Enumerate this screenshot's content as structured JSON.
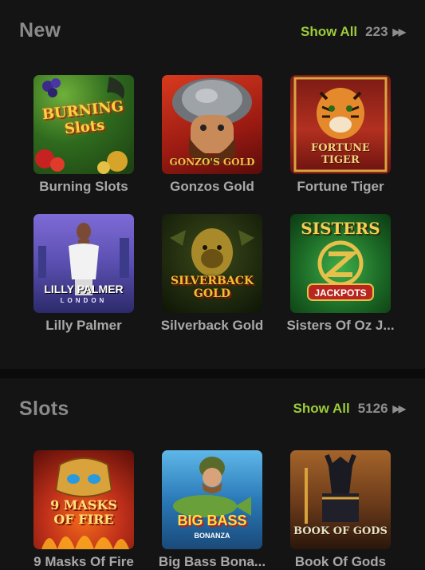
{
  "sections": [
    {
      "title": "New",
      "show_all_label": "Show All",
      "count": "223",
      "games": [
        {
          "name": "Burning Slots",
          "art_text": "BURNING Slots"
        },
        {
          "name": "Gonzos Gold",
          "art_text": "GONZO'S GOLD"
        },
        {
          "name": "Fortune Tiger",
          "art_text": "FORTUNE TIGER"
        },
        {
          "name": "Lilly Palmer",
          "art_text": "LILLY PALMER",
          "art_sub": "LONDON"
        },
        {
          "name": "Silverback Gold",
          "art_text": "SILVERBACK GOLD"
        },
        {
          "name": "Sisters Of Oz J...",
          "art_text": "SISTERS",
          "art_sub": "JACKPOTS"
        }
      ]
    },
    {
      "title": "Slots",
      "show_all_label": "Show All",
      "count": "5126",
      "games": [
        {
          "name": "9 Masks Of Fire",
          "art_text": "9 MASKS OF FIRE"
        },
        {
          "name": "Big Bass Bona...",
          "art_text": "BIG BASS",
          "art_sub": "BONANZA"
        },
        {
          "name": "Book Of Gods",
          "art_text": "BOOK OF GODS"
        }
      ]
    }
  ],
  "colors": {
    "accent": "#9ccc3a",
    "background": "#141414",
    "text_muted": "#a8a8a8"
  },
  "icons": {
    "show_all": "double-chevron-right-icon"
  }
}
